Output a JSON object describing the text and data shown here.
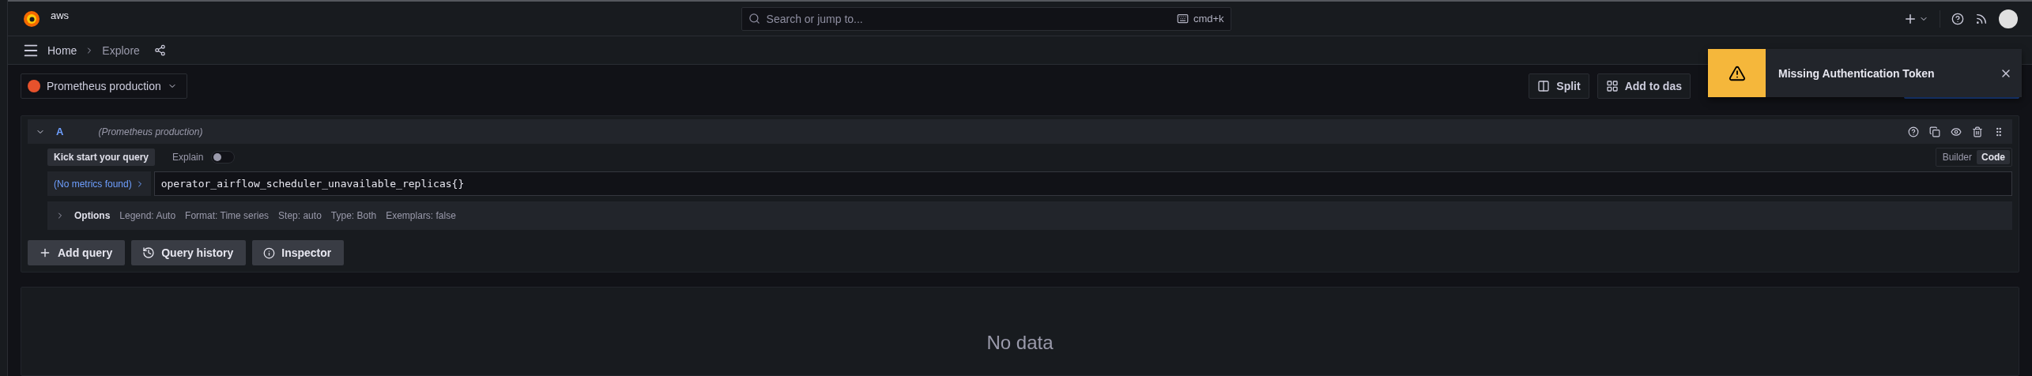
{
  "topbar": {
    "logo_text": "aws",
    "search": {
      "placeholder": "Search or jump to...",
      "shortcut": "cmd+k"
    }
  },
  "breadcrumbs": [
    {
      "label": "Home",
      "current": false
    },
    {
      "label": "Explore",
      "current": true
    }
  ],
  "datasource": "Prometheus production",
  "actions": [
    {
      "label": "Split",
      "kind": "split"
    },
    {
      "label": "Add to das",
      "kind": "dashboard"
    }
  ],
  "query": {
    "ref": "A",
    "datasource": "(Prometheus production)",
    "expanded": true,
    "kick_start": "Kick start your query",
    "explain": {
      "label": "Explain",
      "on": false
    },
    "modes": [
      {
        "label": "Builder",
        "selected": false
      },
      {
        "label": "Code",
        "selected": true
      }
    ],
    "metrics_button": "(No metrics found)",
    "expression": "operator_airflow_scheduler_unavailable_replicas{}",
    "options": {
      "label": "Options",
      "expanded": false,
      "items": [
        "Legend: Auto",
        "Format: Time series",
        "Step: auto",
        "Type: Both",
        "Exemplars: false"
      ]
    }
  },
  "query_buttons": [
    {
      "label": "Add query",
      "kind": "add"
    },
    {
      "label": "Query history",
      "kind": "history"
    },
    {
      "label": "Inspector",
      "kind": "inspect"
    }
  ],
  "result": {
    "message": "No data"
  },
  "toast": {
    "kind": "warning",
    "message": "Missing Authentication Token"
  }
}
